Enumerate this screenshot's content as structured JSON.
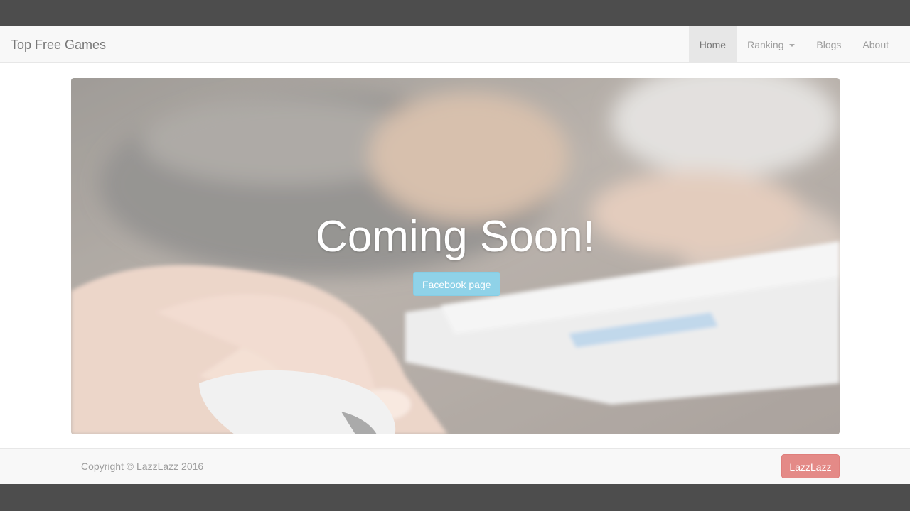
{
  "navbar": {
    "brand": "Top Free Games",
    "items": [
      {
        "label": "Home",
        "active": true
      },
      {
        "label": "Ranking",
        "dropdown": true
      },
      {
        "label": "Blogs"
      },
      {
        "label": "About"
      }
    ]
  },
  "hero": {
    "title": "Coming Soon!",
    "button_label": "Facebook page"
  },
  "footer": {
    "copyright": "Copyright © LazzLazz 2016",
    "button_label": "LazzLazz"
  },
  "colors": {
    "background": "#4d4d4d",
    "info_button": "#8fd2e8",
    "danger_button": "#e48a87"
  }
}
